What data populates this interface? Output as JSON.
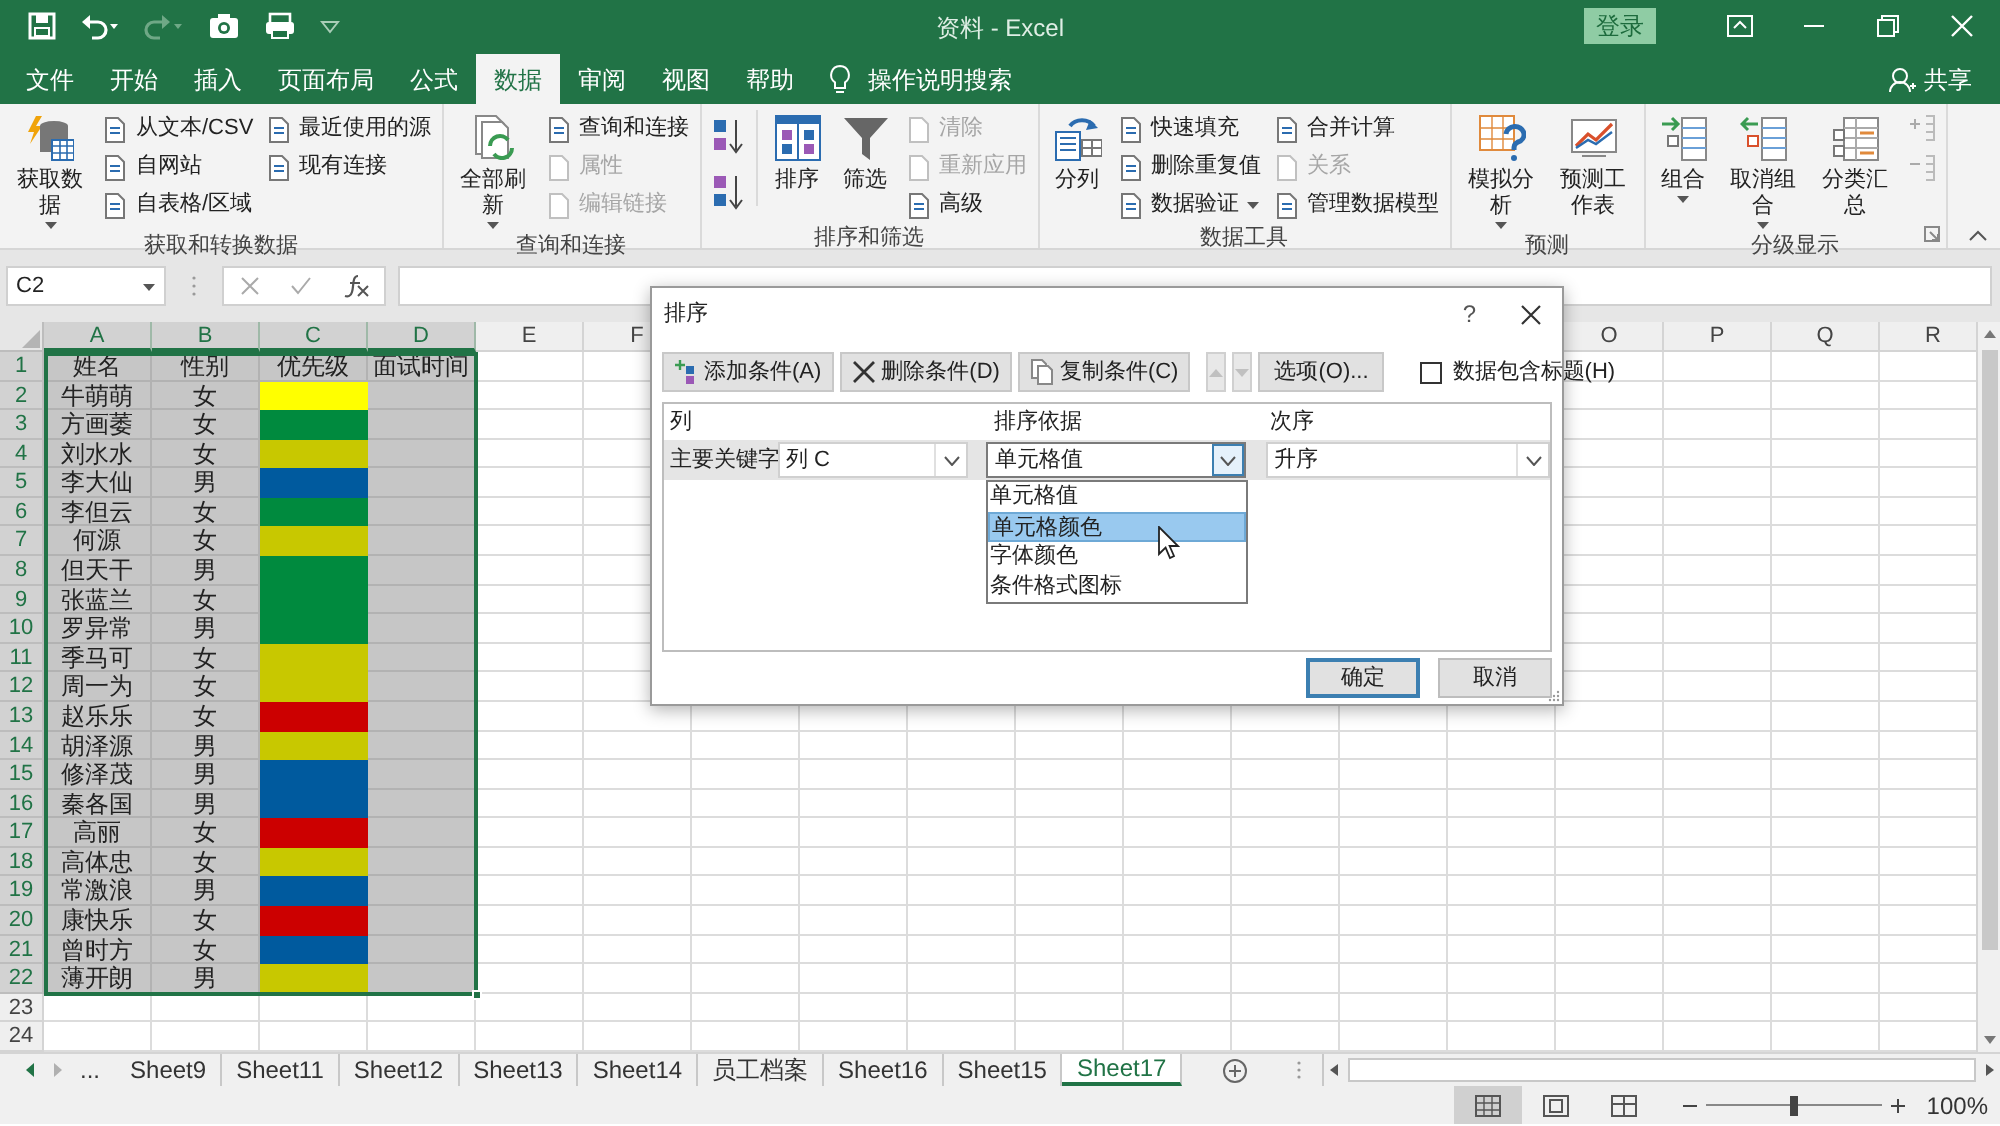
{
  "window": {
    "title": "资料 - Excel",
    "sign_in": "登录"
  },
  "ribbon_tabs": [
    {
      "label": "文件",
      "selected": false
    },
    {
      "label": "开始",
      "selected": false
    },
    {
      "label": "插入",
      "selected": false
    },
    {
      "label": "页面布局",
      "selected": false
    },
    {
      "label": "公式",
      "selected": false
    },
    {
      "label": "数据",
      "selected": true
    },
    {
      "label": "审阅",
      "selected": false
    },
    {
      "label": "视图",
      "selected": false
    },
    {
      "label": "帮助",
      "selected": false
    }
  ],
  "tell_me": "操作说明搜索",
  "share": "共享",
  "ribbon_groups": [
    {
      "label": "获取和转换数据",
      "launcher": false,
      "items": [
        {
          "kind": "large",
          "label": "获取数据",
          "dropdown": true
        },
        {
          "kind": "column",
          "items": [
            {
              "label": "从文本/CSV",
              "disabled": false,
              "dropdown": false
            },
            {
              "label": "自网站",
              "disabled": false,
              "dropdown": false
            },
            {
              "label": "自表格/区域",
              "disabled": false,
              "dropdown": false
            }
          ]
        },
        {
          "kind": "column",
          "items": [
            {
              "label": "最近使用的源",
              "disabled": false,
              "dropdown": false
            },
            {
              "label": "现有连接",
              "disabled": false,
              "dropdown": false
            }
          ]
        }
      ]
    },
    {
      "label": "查询和连接",
      "launcher": false,
      "items": [
        {
          "kind": "large",
          "label": "全部刷新",
          "dropdown": true
        },
        {
          "kind": "column",
          "items": [
            {
              "label": "查询和连接",
              "disabled": false,
              "dropdown": false
            },
            {
              "label": "属性",
              "disabled": true,
              "dropdown": false
            },
            {
              "label": "编辑链接",
              "disabled": true,
              "dropdown": false
            }
          ]
        }
      ]
    },
    {
      "label": "排序和筛选",
      "launcher": false,
      "items": [
        {
          "kind": "sort_icons"
        },
        {
          "kind": "large",
          "label": "排序",
          "dropdown": false
        },
        {
          "kind": "large",
          "label": "筛选",
          "dropdown": false
        },
        {
          "kind": "column",
          "items": [
            {
              "label": "清除",
              "disabled": true,
              "dropdown": false
            },
            {
              "label": "重新应用",
              "disabled": true,
              "dropdown": false
            },
            {
              "label": "高级",
              "disabled": false,
              "dropdown": false
            }
          ]
        }
      ]
    },
    {
      "label": "数据工具",
      "launcher": false,
      "items": [
        {
          "kind": "large",
          "label": "分列",
          "dropdown": false
        },
        {
          "kind": "column",
          "items": [
            {
              "label": "快速填充",
              "disabled": false,
              "dropdown": false
            },
            {
              "label": "删除重复值",
              "disabled": false,
              "dropdown": false
            },
            {
              "label": "数据验证",
              "disabled": false,
              "dropdown": true
            }
          ]
        },
        {
          "kind": "column",
          "items": [
            {
              "label": "合并计算",
              "disabled": false,
              "dropdown": false
            },
            {
              "label": "关系",
              "disabled": true,
              "dropdown": false
            },
            {
              "label": "管理数据模型",
              "disabled": false,
              "dropdown": false
            }
          ]
        }
      ]
    },
    {
      "label": "预测",
      "launcher": false,
      "items": [
        {
          "kind": "large",
          "label": "模拟分析",
          "dropdown": true
        },
        {
          "kind": "large",
          "label": "预测工作表",
          "dropdown": false
        }
      ]
    },
    {
      "label": "分级显示",
      "launcher": true,
      "items": [
        {
          "kind": "large",
          "label": "组合",
          "dropdown": true
        },
        {
          "kind": "large",
          "label": "取消组合",
          "dropdown": true
        },
        {
          "kind": "large",
          "label": "分类汇总",
          "dropdown": false
        },
        {
          "kind": "outline_icons"
        }
      ]
    }
  ],
  "formula_bar": {
    "name_box": "C2"
  },
  "grid": {
    "columns": [
      {
        "label": "A",
        "selected": true
      },
      {
        "label": "B",
        "selected": true
      },
      {
        "label": "C",
        "selected": true
      },
      {
        "label": "D",
        "selected": true
      },
      {
        "label": "E",
        "selected": false
      },
      {
        "label": "F",
        "selected": false
      }
    ],
    "columns_right": [
      {
        "label": "O",
        "selected": false
      },
      {
        "label": "P",
        "selected": false
      },
      {
        "label": "Q",
        "selected": false
      },
      {
        "label": "R",
        "selected": false
      }
    ],
    "rows": [
      {
        "number": "1",
        "selected": true,
        "cells": [
          "姓名",
          "性别",
          "优先级",
          "面试时间"
        ]
      },
      {
        "number": "2",
        "selected": true,
        "cells": [
          "牛萌萌",
          "女"
        ],
        "color": "#ffff00"
      },
      {
        "number": "3",
        "selected": true,
        "cells": [
          "方画萎",
          "女"
        ],
        "color": "#008a3e"
      },
      {
        "number": "4",
        "selected": true,
        "cells": [
          "刘水水",
          "女"
        ],
        "color": "#c8c800"
      },
      {
        "number": "5",
        "selected": true,
        "cells": [
          "李大仙",
          "男"
        ],
        "color": "#005a9e"
      },
      {
        "number": "6",
        "selected": true,
        "cells": [
          "李但云",
          "女"
        ],
        "color": "#008a3e"
      },
      {
        "number": "7",
        "selected": true,
        "cells": [
          "何源",
          "女"
        ],
        "color": "#c8c800"
      },
      {
        "number": "8",
        "selected": true,
        "cells": [
          "但天干",
          "男"
        ],
        "color": "#008a3e"
      },
      {
        "number": "9",
        "selected": true,
        "cells": [
          "张蓝兰",
          "女"
        ],
        "color": "#008a3e"
      },
      {
        "number": "10",
        "selected": true,
        "cells": [
          "罗异常",
          "男"
        ],
        "color": "#008a3e"
      },
      {
        "number": "11",
        "selected": true,
        "cells": [
          "季马可",
          "女"
        ],
        "color": "#c8c800"
      },
      {
        "number": "12",
        "selected": true,
        "cells": [
          "周一为",
          "女"
        ],
        "color": "#c8c800"
      },
      {
        "number": "13",
        "selected": true,
        "cells": [
          "赵乐乐",
          "女"
        ],
        "color": "#cc0000"
      },
      {
        "number": "14",
        "selected": true,
        "cells": [
          "胡泽源",
          "男"
        ],
        "color": "#c8c800"
      },
      {
        "number": "15",
        "selected": true,
        "cells": [
          "修泽茂",
          "男"
        ],
        "color": "#005a9e"
      },
      {
        "number": "16",
        "selected": true,
        "cells": [
          "秦各国",
          "男"
        ],
        "color": "#005a9e"
      },
      {
        "number": "17",
        "selected": true,
        "cells": [
          "高丽",
          "女"
        ],
        "color": "#cc0000"
      },
      {
        "number": "18",
        "selected": true,
        "cells": [
          "高体忠",
          "女"
        ],
        "color": "#c8c800"
      },
      {
        "number": "19",
        "selected": true,
        "cells": [
          "常激浪",
          "男"
        ],
        "color": "#005a9e"
      },
      {
        "number": "20",
        "selected": true,
        "cells": [
          "康快乐",
          "女"
        ],
        "color": "#cc0000"
      },
      {
        "number": "21",
        "selected": true,
        "cells": [
          "曾时方",
          "女"
        ],
        "color": "#005a9e"
      },
      {
        "number": "22",
        "selected": true,
        "cells": [
          "薄开朗",
          "男"
        ],
        "color": "#c8c800"
      },
      {
        "number": "23",
        "selected": false
      },
      {
        "number": "24",
        "selected": false
      }
    ]
  },
  "dialog": {
    "title": "排序",
    "help": "?",
    "buttons": [
      "添加条件(A)",
      "删除条件(D)",
      "复制条件(C)"
    ],
    "move_buttons_disabled": true,
    "options_button": "选项(O)...",
    "header_checkbox": {
      "label": "数据包含标题(H)",
      "checked": false
    },
    "columns": [
      "列",
      "排序依据",
      "次序"
    ],
    "rule": {
      "label": "主要关键字",
      "column": "列 C",
      "sort_on": "单元格值",
      "order": "升序"
    },
    "sort_on_options": [
      {
        "label": "单元格值",
        "selected": false
      },
      {
        "label": "单元格颜色",
        "selected": true
      },
      {
        "label": "字体颜色",
        "selected": false
      },
      {
        "label": "条件格式图标",
        "selected": false
      }
    ],
    "ok": "确定",
    "cancel": "取消"
  },
  "more_tabs": "...",
  "sheet_tabs": [
    {
      "label": "Sheet9",
      "selected": false
    },
    {
      "label": "Sheet11",
      "selected": false
    },
    {
      "label": "Sheet12",
      "selected": false
    },
    {
      "label": "Sheet13",
      "selected": false
    },
    {
      "label": "Sheet14",
      "selected": false
    },
    {
      "label": "员工档案",
      "selected": false
    },
    {
      "label": "Sheet16",
      "selected": false
    },
    {
      "label": "Sheet15",
      "selected": false
    },
    {
      "label": "Sheet17",
      "selected": true
    }
  ],
  "status_bar": {
    "view_buttons": [
      {
        "kind": "normal",
        "selected": true
      },
      {
        "kind": "page_layout",
        "selected": false
      },
      {
        "kind": "page_break",
        "selected": false
      }
    ],
    "zoom_slider": {
      "level": 0.5
    },
    "zoom": "100%"
  }
}
